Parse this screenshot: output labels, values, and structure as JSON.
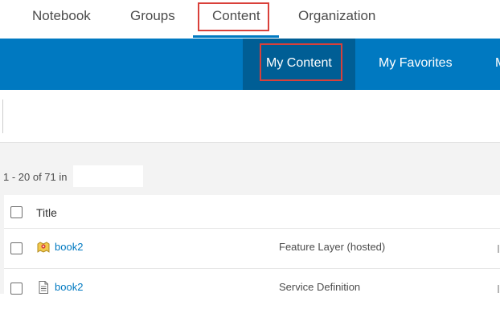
{
  "top_nav": {
    "items": [
      {
        "label": "Notebook"
      },
      {
        "label": "Groups"
      },
      {
        "label": "Content"
      },
      {
        "label": "Organization"
      }
    ],
    "active": "Content"
  },
  "sub_nav": {
    "tabs": [
      {
        "label": "My Content"
      },
      {
        "label": "My Favorites"
      },
      {
        "label": "M"
      }
    ],
    "active": "My Content"
  },
  "results": {
    "count_text": "1 - 20 of 71 in",
    "folder_value": ""
  },
  "table": {
    "columns": [
      "Title"
    ],
    "rows": [
      {
        "title": "book2",
        "type": "Feature Layer (hosted)",
        "icon": "feature-layer-icon"
      },
      {
        "title": "book2",
        "type": "Service Definition",
        "icon": "document-icon"
      }
    ]
  },
  "colors": {
    "brand_blue": "#0079c1",
    "active_tab_blue": "#005e95",
    "highlight_red": "#d9403a"
  }
}
